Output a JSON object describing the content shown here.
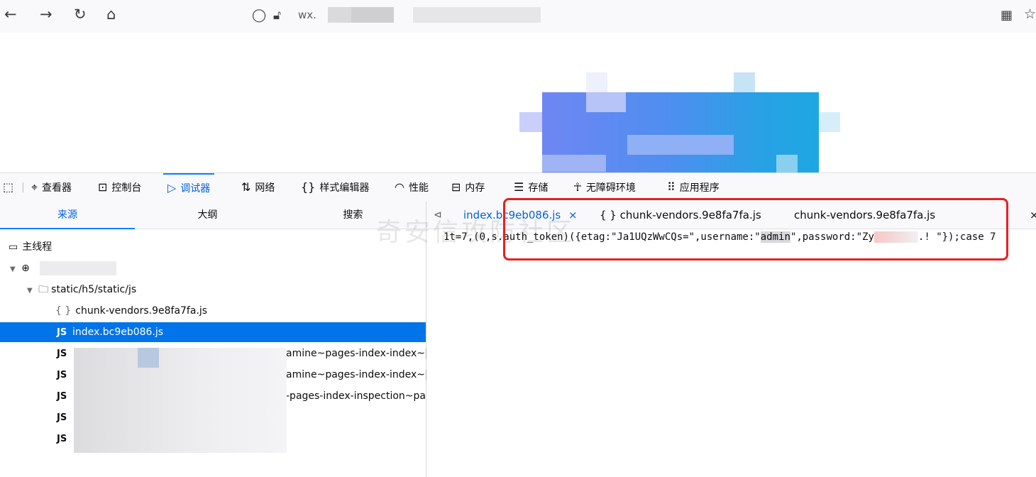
{
  "browser": {
    "url_prefix": "wx."
  },
  "devtools": {
    "tabs": [
      {
        "label": "查看器",
        "icon": "inspector-icon"
      },
      {
        "label": "控制台",
        "icon": "console-icon"
      },
      {
        "label": "调试器",
        "icon": "debugger-icon"
      },
      {
        "label": "网络",
        "icon": "network-icon"
      },
      {
        "label": "样式编辑器",
        "icon": "style-editor-icon"
      },
      {
        "label": "性能",
        "icon": "performance-icon"
      },
      {
        "label": "内存",
        "icon": "memory-icon"
      },
      {
        "label": "存储",
        "icon": "storage-icon"
      },
      {
        "label": "无障碍环境",
        "icon": "accessibility-icon"
      },
      {
        "label": "应用程序",
        "icon": "application-icon"
      }
    ],
    "active_tab": "调试器",
    "left_panel": {
      "tabs": [
        "来源",
        "大纲",
        "搜索"
      ],
      "tree": {
        "main_thread": "主线程",
        "folder": "static/h5/static/js",
        "files": [
          {
            "badge": "{ }",
            "name": "chunk-vendors.9e8fa7fa.js"
          },
          {
            "badge": "JS",
            "name": "index.bc9eb086.js",
            "selected": true
          },
          {
            "badge": "JS",
            "name": "amine~pages-index-index~|"
          },
          {
            "badge": "JS",
            "name": "amine~pages-index-index~|"
          },
          {
            "badge": "JS",
            "name": "-pages-index-inspection~pa"
          },
          {
            "badge": "JS",
            "name": ""
          },
          {
            "badge": "JS",
            "name": ""
          }
        ]
      }
    },
    "editor": {
      "tabs": [
        {
          "label": "index.bc9eb086.js",
          "active": true,
          "close": "×"
        },
        {
          "label": "{ } chunk-vendors.9e8fa7fa.js"
        },
        {
          "label": "chunk-vendors.9e8fa7fa.js"
        }
      ],
      "code": {
        "pre": "1t=7,(0,s.auth_token)({etag:\"Ja1UQzWwCQs=\",username:\"",
        "highlight": "admin",
        "mid": "\",password:\"Zy",
        "post": ".! \"});case 7"
      }
    },
    "watermark": "奇安信攻防社区"
  },
  "colors": {
    "accent": "#0a84ff",
    "selected_row": "#0074e8",
    "annotation_box": "#e52222"
  }
}
